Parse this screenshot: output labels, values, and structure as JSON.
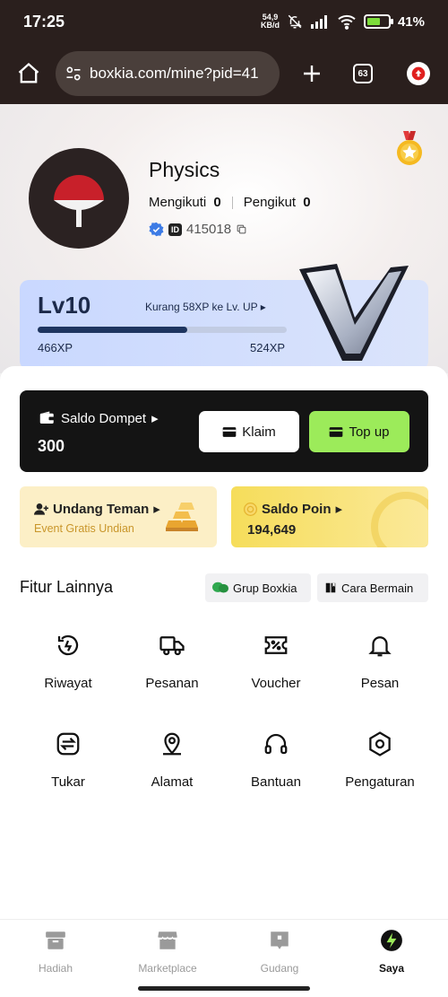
{
  "status_bar": {
    "time": "17:25",
    "net_speed_value": "54,9",
    "net_speed_unit": "KB/d",
    "battery_percent": "41%"
  },
  "browser": {
    "url": "boxkia.com/mine?pid=41",
    "tabs_count": "63"
  },
  "profile": {
    "name": "Physics",
    "following_label": "Mengikuti",
    "following_count": "0",
    "followers_label": "Pengikut",
    "followers_count": "0",
    "id_badge": "ID",
    "id_value": "415018"
  },
  "level": {
    "title": "Lv10",
    "hint": "Kurang 58XP ke Lv. UP",
    "min_xp": "466XP",
    "max_xp": "524XP",
    "progress_fraction": 0.6
  },
  "wallet": {
    "label": "Saldo Dompet",
    "value": "300",
    "klaim_label": "Klaim",
    "topup_label": "Top up"
  },
  "invite": {
    "title": "Undang Teman",
    "subtitle": "Event Gratis Undian"
  },
  "points": {
    "title": "Saldo Poin",
    "value": "194,649"
  },
  "features": {
    "title": "Fitur Lainnya",
    "chip_grup": "Grup Boxkia",
    "chip_cara": "Cara Bermain",
    "items": [
      {
        "label": "Riwayat",
        "icon": "history-icon"
      },
      {
        "label": "Pesanan",
        "icon": "truck-icon"
      },
      {
        "label": "Voucher",
        "icon": "voucher-icon"
      },
      {
        "label": "Pesan",
        "icon": "bell-icon"
      },
      {
        "label": "Tukar",
        "icon": "exchange-icon"
      },
      {
        "label": "Alamat",
        "icon": "location-icon"
      },
      {
        "label": "Bantuan",
        "icon": "headset-icon"
      },
      {
        "label": "Pengaturan",
        "icon": "settings-icon"
      }
    ]
  },
  "bottom_nav": {
    "items": [
      {
        "label": "Hadiah",
        "icon": "gift-box-icon"
      },
      {
        "label": "Marketplace",
        "icon": "store-icon"
      },
      {
        "label": "Gudang",
        "icon": "warehouse-icon"
      },
      {
        "label": "Saya",
        "icon": "bolt-icon"
      }
    ],
    "active_index": 3
  },
  "colors": {
    "topbar_bg": "#2a1f1d",
    "accent_green": "#9ceb5a",
    "level_card_bg": "#c9d8ff",
    "points_yellow": "#f6dd5a",
    "invite_bg": "#fcefc6"
  }
}
